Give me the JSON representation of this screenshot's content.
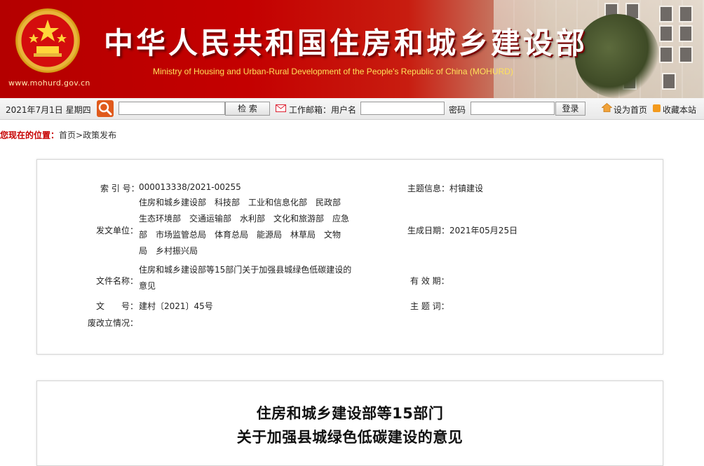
{
  "banner": {
    "site_url": "www.mohurd.gov.cn",
    "title": "中华人民共和国住房和城乡建设部",
    "subtitle": "Ministry of Housing and Urban-Rural Development of the People's Republic of China (MOHURD)",
    "colors": {
      "primary_red": "#c40000",
      "title_white": "#ffffff",
      "subtitle_yellow": "#ffe25a"
    },
    "icons": [
      "national-emblem-icon"
    ]
  },
  "toolbar": {
    "date": "2021年7月1日 星期四",
    "search_placeholder": "",
    "search_button": "检 索",
    "mail_label": "工作邮箱：用户名",
    "username_value": "",
    "password_label": "密码",
    "password_value": "",
    "login_button": "登录",
    "set_home": "设为首页",
    "bookmark": "收藏本站",
    "icons": [
      "search-icon",
      "mail-icon",
      "home-icon",
      "rss-icon"
    ]
  },
  "breadcrumb": {
    "label": "您现在的位置：",
    "home": "首页",
    "separator": ">",
    "current": "政策发布",
    "label_color": "#c60000"
  },
  "meta": {
    "index_label": "索 引 号：",
    "index_value": "000013338/2021-00255",
    "topic_label": "主题信息：",
    "topic_value": "村镇建设",
    "issuer_label": "发文单位：",
    "issuer_lines": [
      "住房和城乡建设部　科技部　工业和信息化部　民政部",
      "生态环境部　交通运输部　水利部　文化和旅游部　应急",
      "部　市场监管总局　体育总局　能源局　林草局　文物",
      "局　乡村振兴局"
    ],
    "date_label": "生成日期：",
    "date_value": "2021年05月25日",
    "name_label": "文件名称：",
    "name_lines": [
      "住房和城乡建设部等15部门关于加强县城绿色低碳建设的",
      "意见"
    ],
    "validity_label": "有 效 期：",
    "validity_value": "",
    "doc_no_label": "文　　号：",
    "doc_no_value": "建村〔2021〕45号",
    "keyword_label": "主 题 词：",
    "keyword_value": "",
    "status_label": "废改立情况：",
    "status_value": ""
  },
  "document": {
    "title_line1": "住房和城乡建设部等15部门",
    "title_line2": "关于加强县城绿色低碳建设的意见"
  }
}
